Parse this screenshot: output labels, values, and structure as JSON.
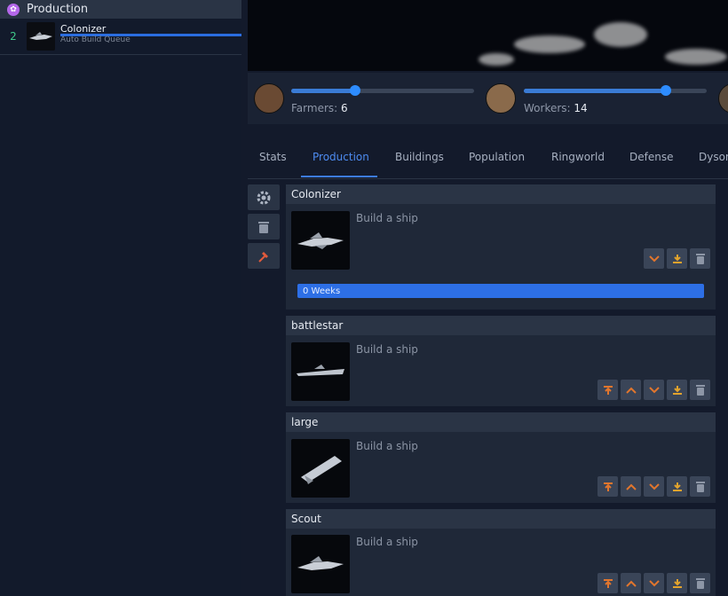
{
  "sidebar": {
    "title": "Production",
    "queue": [
      {
        "index": "2",
        "name": "Colonizer",
        "subtitle": "Auto Build Queue"
      }
    ]
  },
  "sliders": {
    "farmers_label": "Farmers:",
    "farmers_value": "6",
    "workers_label": "Workers:",
    "workers_value": "14"
  },
  "tabs": [
    "Stats",
    "Production",
    "Buildings",
    "Population",
    "Ringworld",
    "Defense",
    "Dyson"
  ],
  "active_tab": "Production",
  "cards": [
    {
      "name": "Colonizer",
      "desc": "Build a ship",
      "progress": "0 Weeks"
    },
    {
      "name": "battlestar",
      "desc": "Build a ship"
    },
    {
      "name": "large",
      "desc": "Build a ship"
    },
    {
      "name": "Scout",
      "desc": "Build a ship"
    }
  ],
  "colors": {
    "accent": "#3d7ce8",
    "orange": "#e2762d",
    "queue_index": "#40c98a"
  }
}
